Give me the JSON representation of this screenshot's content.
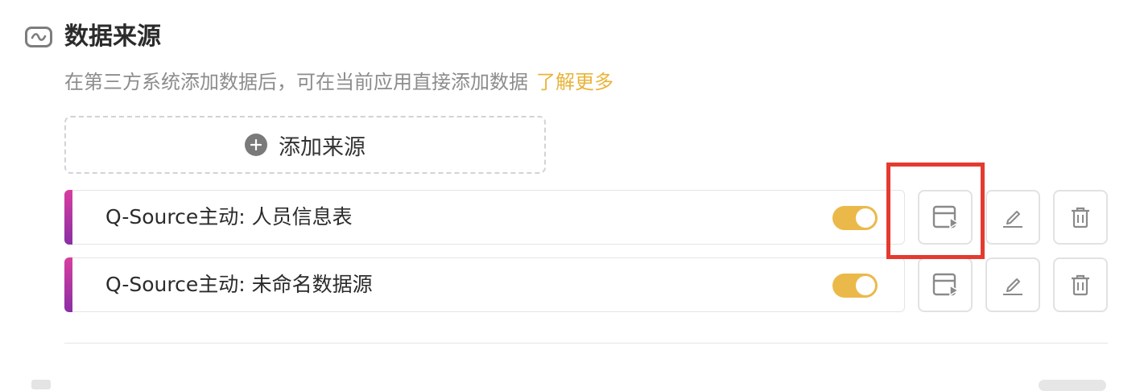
{
  "section": {
    "icon": "data-source-icon",
    "title": "数据来源",
    "description": "在第三方系统添加数据后，可在当前应用直接添加数据",
    "learn_more": "了解更多"
  },
  "add_source": {
    "icon": "plus-circle-icon",
    "label": "添加来源"
  },
  "sources": [
    {
      "label": "Q-Source主动: 人员信息表",
      "enabled": true
    },
    {
      "label": "Q-Source主动: 未命名数据源",
      "enabled": true
    }
  ],
  "actions": {
    "preview_icon": "preview-icon",
    "edit_icon": "edit-icon",
    "delete_icon": "delete-icon"
  },
  "colors": {
    "accent_link": "#e9b43b",
    "toggle_on": "#ebb94a",
    "row_accent_top": "#d83ea0",
    "row_accent_bottom": "#8a2fa5",
    "highlight_box": "#e53a2f"
  }
}
